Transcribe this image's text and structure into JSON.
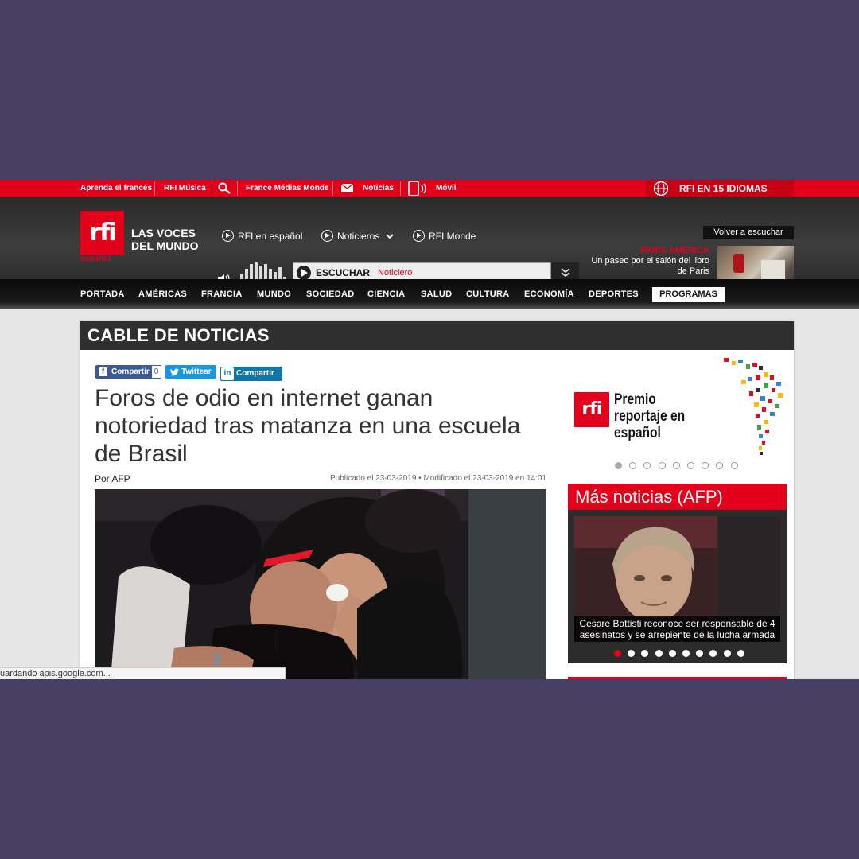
{
  "topbar": {
    "links": [
      "Aprenda el francés",
      "RFI Música",
      "France Médias Monde",
      "Noticias",
      "Móvil"
    ],
    "idiomas": "RFI EN 15 IDIOMAS"
  },
  "header": {
    "logo": "rfi",
    "logo_sub": "español",
    "tagline": "LAS VOCES DEL MUNDO",
    "radio_links": [
      "RFI en español",
      "Noticieros",
      "RFI Monde"
    ],
    "player_label": "ESCUCHAR",
    "player_program": "Noticiero",
    "volver": "Volver a escuchar",
    "promo_title": "PARIS AMÉRICA",
    "promo_text": "Un paseo por el salón del libro de Paris"
  },
  "nav": {
    "items": [
      "PORTADA",
      "AMÉRICAS",
      "FRANCIA",
      "MUNDO",
      "SOCIEDAD",
      "CIENCIA",
      "SALUD",
      "CULTURA",
      "ECONOMÍA",
      "DEPORTES"
    ],
    "active": "PROGRAMAS"
  },
  "article": {
    "section": "CABLE DE NOTICIAS",
    "share": {
      "facebook": "Compartir",
      "facebook_count": "0",
      "twitter": "Twittear",
      "linkedin": "Compartir"
    },
    "headline": "Foros de odio en internet ganan notoriedad tras matanza en una escuela de Brasil",
    "byline": "Por AFP",
    "dates": "Publicado el 23-03-2019 • Modificado el 23-03-2019 en 14:01"
  },
  "sidebar": {
    "premio_logo": "rfi",
    "premio_text": "Premio reportaje en español",
    "premio_dots": 9,
    "premio_active": 0,
    "mas_title": "Más noticias (AFP)",
    "mas_caption": "Cesare Battisti reconoce ser responsable de 4 asesinatos y se arrepiente de la lucha armada",
    "mas_dots": 10,
    "mas_active": 0
  },
  "status_text": "uardando apis.google.com...",
  "colors": {
    "brand_red": "#e2001a",
    "background": "#463f63",
    "header_dark": "#333333"
  }
}
